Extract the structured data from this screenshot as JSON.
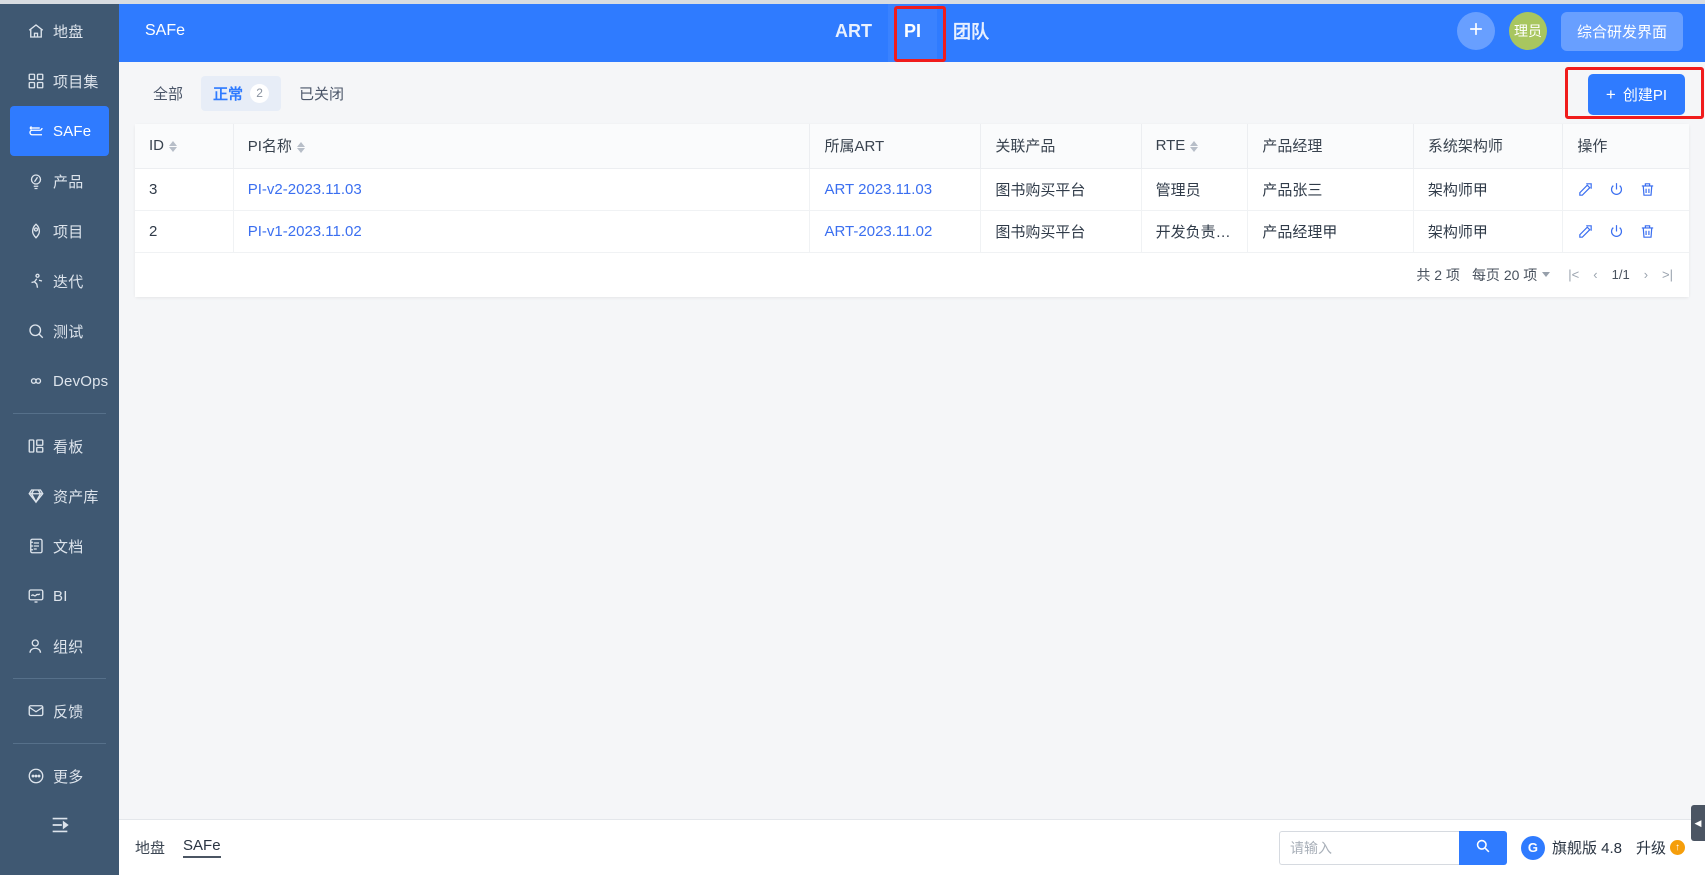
{
  "sidebar": {
    "items": [
      {
        "label": "地盘",
        "icon": "home-icon",
        "active": false
      },
      {
        "label": "项目集",
        "icon": "grid-icon",
        "active": false
      },
      {
        "label": "SAFe",
        "icon": "safe-icon",
        "active": true
      },
      {
        "label": "产品",
        "icon": "bulb-icon",
        "active": false
      },
      {
        "label": "项目",
        "icon": "rocket-icon",
        "active": false
      },
      {
        "label": "迭代",
        "icon": "runner-icon",
        "active": false
      },
      {
        "label": "测试",
        "icon": "search-circle-icon",
        "active": false
      },
      {
        "label": "DevOps",
        "icon": "infinity-icon",
        "active": false
      },
      {
        "label": "看板",
        "icon": "board-icon",
        "active": false
      },
      {
        "label": "资产库",
        "icon": "diamond-icon",
        "active": false
      },
      {
        "label": "文档",
        "icon": "document-icon",
        "active": false
      },
      {
        "label": "BI",
        "icon": "monitor-icon",
        "active": false
      },
      {
        "label": "组织",
        "icon": "user-icon",
        "active": false
      },
      {
        "label": "反馈",
        "icon": "feedback-icon",
        "active": false
      },
      {
        "label": "更多",
        "icon": "more-dots-icon",
        "active": false
      }
    ],
    "collapse_icon": "collapse-icon"
  },
  "topbar": {
    "title": "SAFe",
    "tabs": [
      {
        "label": "ART",
        "active": false
      },
      {
        "label": "PI",
        "active": true
      },
      {
        "label": "团队",
        "active": false
      }
    ],
    "add_icon": "plus-icon",
    "avatar_text": "理员",
    "workspace_button": "综合研发界面"
  },
  "filters": {
    "tabs": [
      {
        "label": "全部",
        "count": null,
        "active": false
      },
      {
        "label": "正常",
        "count": "2",
        "active": true
      },
      {
        "label": "已关闭",
        "count": null,
        "active": false
      }
    ],
    "create_button": "创建PI",
    "create_icon": "plus-icon"
  },
  "table": {
    "columns": [
      {
        "label": "ID",
        "sortable": true
      },
      {
        "label": "PI名称",
        "sortable": true
      },
      {
        "label": "所属ART",
        "sortable": false
      },
      {
        "label": "关联产品",
        "sortable": false
      },
      {
        "label": "RTE",
        "sortable": true
      },
      {
        "label": "产品经理",
        "sortable": false
      },
      {
        "label": "系统架构师",
        "sortable": false
      },
      {
        "label": "操作",
        "sortable": false
      }
    ],
    "rows": [
      {
        "id": "3",
        "pi_name": "PI-v2-2023.11.03",
        "art": "ART 2023.11.03",
        "product": "图书购买平台",
        "rte": "管理员",
        "product_manager": "产品张三",
        "architect": "架构师甲"
      },
      {
        "id": "2",
        "pi_name": "PI-v1-2023.11.02",
        "art": "ART-2023.11.02",
        "product": "图书购买平台",
        "rte": "开发负责人甲",
        "product_manager": "产品经理甲",
        "architect": "架构师甲"
      }
    ],
    "row_actions": [
      {
        "icon": "edit-icon",
        "name": "edit-row-button"
      },
      {
        "icon": "power-icon",
        "name": "toggle-row-button"
      },
      {
        "icon": "trash-icon",
        "name": "delete-row-button"
      }
    ]
  },
  "pagination": {
    "total_text": "共 2 项",
    "page_size_text": "每页 20 项",
    "current_page": "1/1",
    "first_icon": "|<",
    "prev_icon": "‹",
    "next_icon": "›",
    "last_icon": ">|"
  },
  "footer": {
    "crumbs": [
      {
        "label": "地盘",
        "current": false
      },
      {
        "label": "SAFe",
        "current": true
      }
    ],
    "search_placeholder": "请输入",
    "search_value": "",
    "search_icon": "search-icon",
    "brand_text": "旗舰版 4.8",
    "brand_logo": "G",
    "upgrade_text": "升级",
    "upgrade_icon": "up-arrow-icon",
    "edge_tab_icon": "◀"
  },
  "colors": {
    "accent": "#2f7bff",
    "sidebar": "#3f5872",
    "link": "#3b6ff0",
    "avatar": "#a8c65f",
    "annotation": "#f01c1c"
  }
}
